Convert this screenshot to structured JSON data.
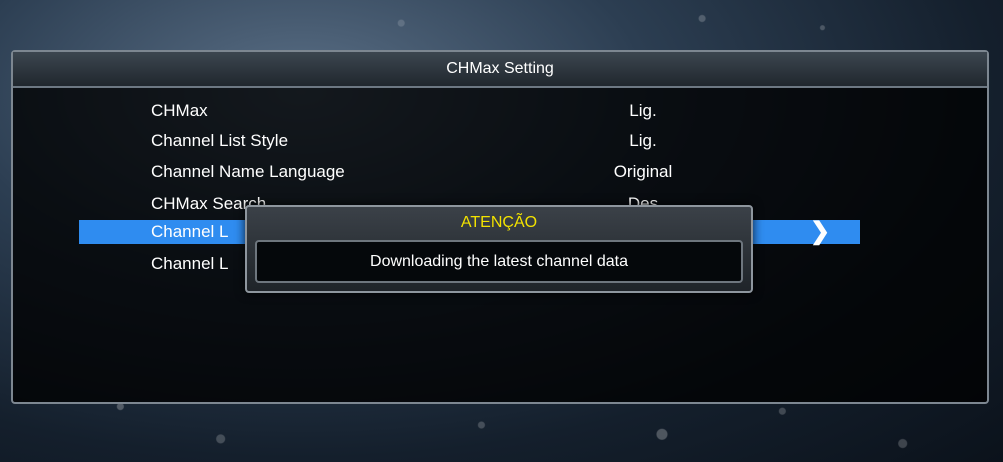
{
  "panel": {
    "title": "CHMax Setting",
    "rows": [
      {
        "label": "CHMax",
        "value": "Lig."
      },
      {
        "label": "Channel List Style",
        "value": "Lig."
      },
      {
        "label": "Channel Name Language",
        "value": "Original"
      },
      {
        "label": "CHMax Search",
        "value": "Des"
      },
      {
        "label": "Channel L",
        "value": ""
      },
      {
        "label": "Channel L",
        "value": ""
      }
    ],
    "selected_index": 4
  },
  "dialog": {
    "title": "ATENÇÃO",
    "message": "Downloading the latest channel data"
  },
  "colors": {
    "highlight": "#2f8cf0",
    "dialog_title": "#f2e200"
  },
  "icons": {
    "selected_arrow": "chevron-right-icon"
  }
}
